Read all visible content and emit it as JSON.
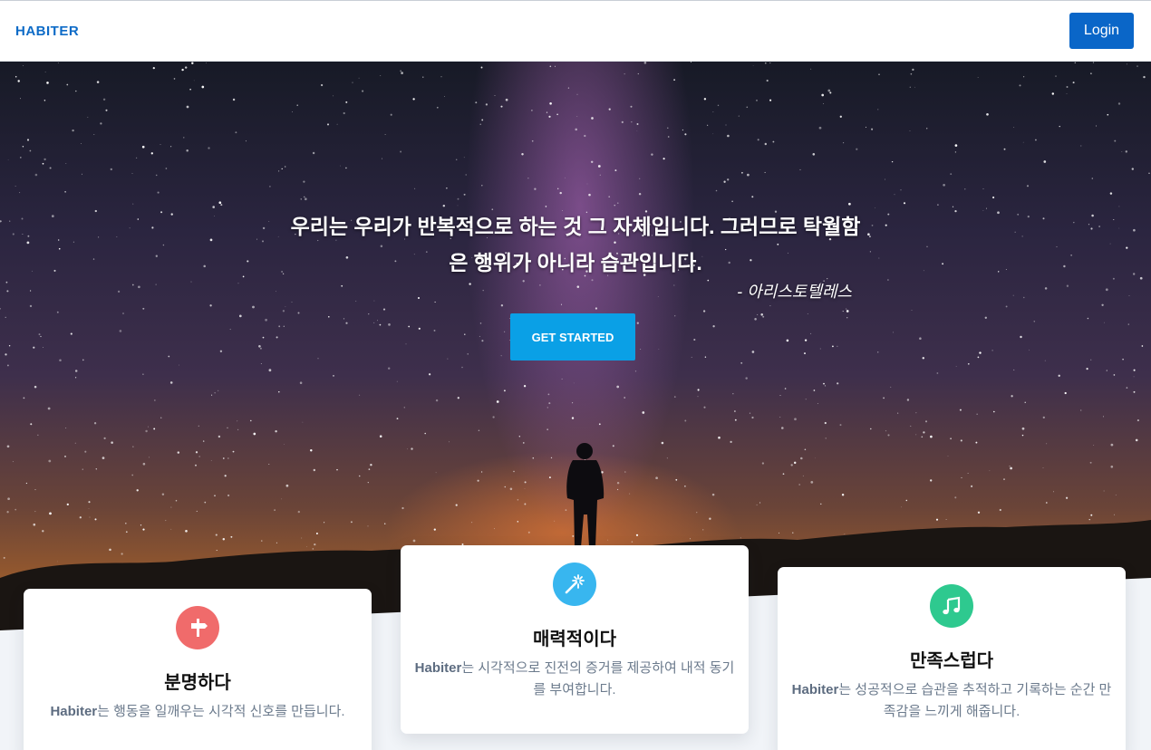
{
  "nav": {
    "brand": "HABITER",
    "login_label": "Login"
  },
  "hero": {
    "quote": "우리는 우리가 반복적으로 하는 것 그 자체입니다. 그러므로 탁월함은 행위가 아니라 습관입니다.",
    "author": "- 아리스토텔레스",
    "cta_label": "GET STARTED"
  },
  "features": [
    {
      "icon": "signpost-icon",
      "color": "#f06b6b",
      "title": "분명하다",
      "brand": "Habiter",
      "text": "는 행동을 일깨우는 시각적 신호를 만듭니다."
    },
    {
      "icon": "magic-wand-icon",
      "color": "#38b6ef",
      "title": "매력적이다",
      "brand": "Habiter",
      "text": "는 시각적으로 진전의 증거를 제공하여 내적 동기를 부여합니다."
    },
    {
      "icon": "music-note-icon",
      "color": "#2ec98f",
      "title": "만족스럽다",
      "brand": "Habiter",
      "text": "는 성공적으로 습관을 추적하고 기록하는 순간 만족감을 느끼게 해줍니다."
    }
  ]
}
